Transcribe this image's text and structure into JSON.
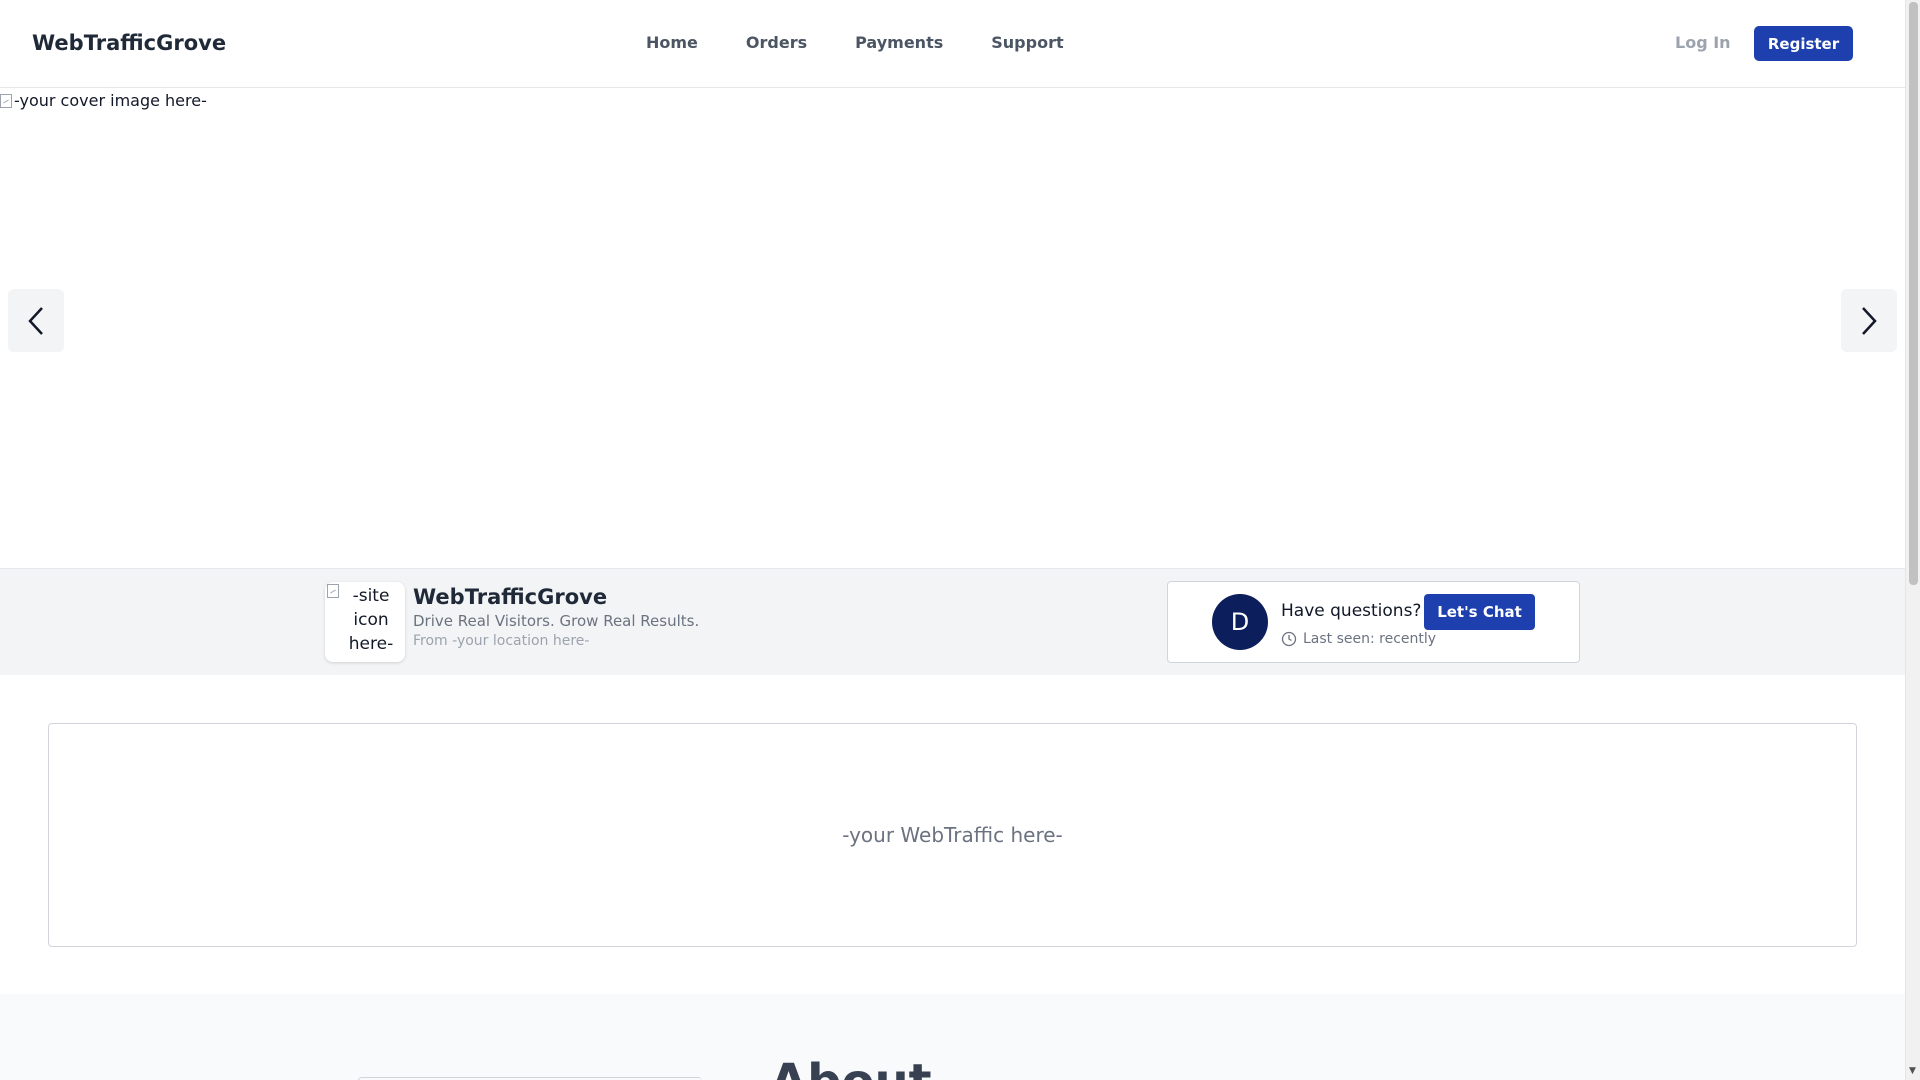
{
  "header": {
    "brand": "WebTrafficGrove",
    "nav": [
      "Home",
      "Orders",
      "Payments",
      "Support"
    ],
    "login": "Log In",
    "register": "Register"
  },
  "cover": {
    "alt_text": "-your cover image here-",
    "prev_icon": "chevron-left-icon",
    "next_icon": "chevron-right-icon"
  },
  "profile": {
    "icon_alt": "-site icon here-",
    "name": "WebTrafficGrove",
    "tagline": "Drive Real Visitors. Grow Real Results.",
    "location": "From -your location here-",
    "chat": {
      "avatar_letter": "D",
      "question": "Have questions?",
      "button": "Let's Chat",
      "last_seen": "Last seen: recently",
      "clock_icon": "clock-icon"
    }
  },
  "content": {
    "placeholder": "-your WebTraffic here-"
  },
  "about": {
    "title": "About"
  },
  "colors": {
    "accent": "#1e40af",
    "avatar": "#0c1e5b",
    "profile_bg": "#f3f4f6"
  }
}
